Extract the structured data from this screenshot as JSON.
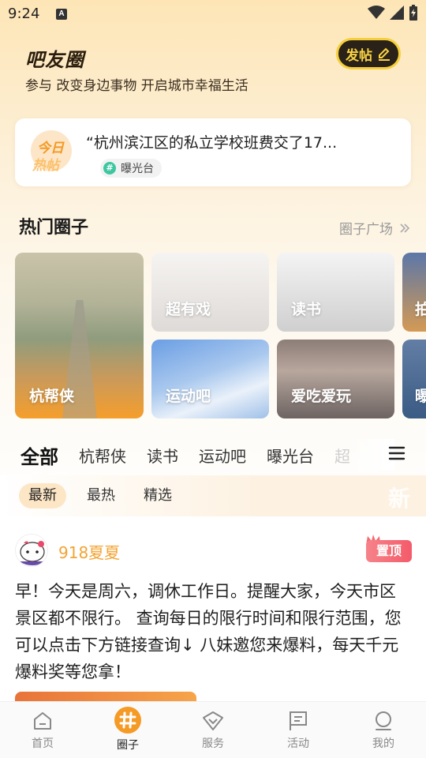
{
  "status_bar": {
    "time": "9:24",
    "indicator": "A"
  },
  "header": {
    "brand": "吧友圈",
    "subtitle": "参与 改变身边事物 开启城市幸福生活",
    "post_button_label": "发帖"
  },
  "hot_post": {
    "badge_line1": "今日",
    "badge_line2": "热帖",
    "title": "“杭州滨江区的私立学校班费交了17...",
    "tag": "曝光台"
  },
  "hot_circles": {
    "title": "热门圈子",
    "more_label": "圈子广场",
    "tiles": [
      {
        "label": "杭帮侠"
      },
      {
        "label": "超有戏"
      },
      {
        "label": "读书"
      },
      {
        "label": "拍"
      },
      {
        "label": "运动吧"
      },
      {
        "label": "爱吃爱玩"
      },
      {
        "label": "曝"
      }
    ]
  },
  "category_tabs": [
    "全部",
    "杭帮侠",
    "读书",
    "运动吧",
    "曝光台",
    "超"
  ],
  "sort_options": [
    "最新",
    "最热",
    "精选"
  ],
  "sort_watermark": "新",
  "post": {
    "username": "918夏夏",
    "pin_label": "置顶",
    "text": "早！今天是周六，调休工作日。提醒大家，今天市区景区都不限行。 查询每日的限行时间和限行范围，您可以点击下方链接查询↓ 八妹邀您来爆料，每天千元爆料奖等您拿！"
  },
  "bottom_nav": [
    {
      "label": "首页",
      "icon": "home-icon"
    },
    {
      "label": "圈子",
      "icon": "circle-hash-icon"
    },
    {
      "label": "服务",
      "icon": "service-icon"
    },
    {
      "label": "活动",
      "icon": "flag-icon"
    },
    {
      "label": "我的",
      "icon": "profile-icon"
    }
  ],
  "colors": {
    "accent": "#f39a25",
    "username": "#f2a434",
    "pin": "#f45b6a"
  }
}
